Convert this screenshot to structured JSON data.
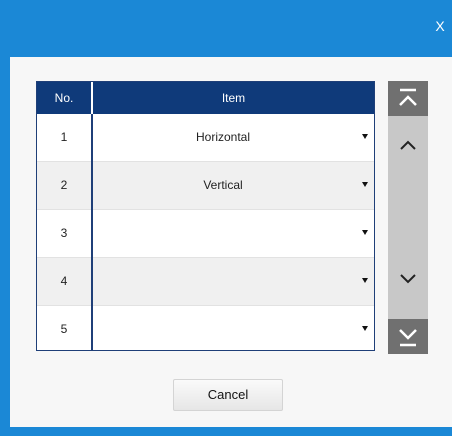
{
  "window": {
    "close_label": "X"
  },
  "table": {
    "headers": {
      "no": "No.",
      "item": "Item"
    },
    "rows": [
      {
        "no": "1",
        "item": "Horizontal"
      },
      {
        "no": "2",
        "item": "Vertical"
      },
      {
        "no": "3",
        "item": ""
      },
      {
        "no": "4",
        "item": ""
      },
      {
        "no": "5",
        "item": ""
      }
    ]
  },
  "scrollbar": {
    "icons": [
      "scroll-to-top-icon",
      "scroll-up-icon",
      "scroll-down-icon",
      "scroll-to-bottom-icon"
    ]
  },
  "footer": {
    "cancel_label": "Cancel"
  },
  "colors": {
    "titlebar": "#1b88d6",
    "header": "#0f3a7a",
    "scroll_button": "#707070"
  }
}
